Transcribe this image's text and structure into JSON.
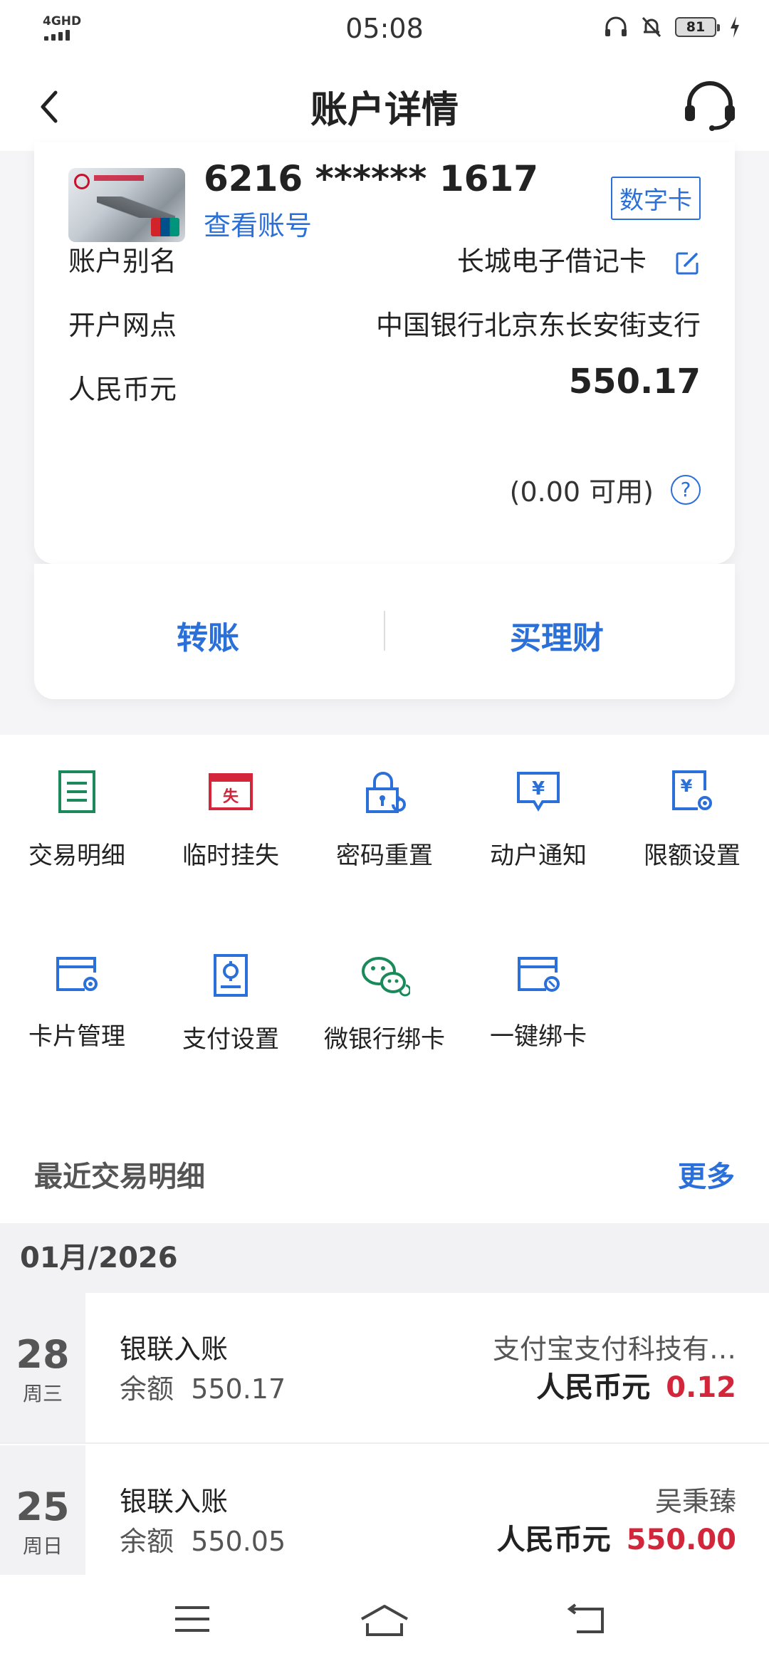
{
  "status_bar": {
    "network": "4GHD",
    "time": "05:08",
    "battery": "81"
  },
  "nav": {
    "title": "账户详情"
  },
  "account": {
    "card_number": "6216 ****** 1617",
    "view_account": "查看账号",
    "card_type_badge": "数字卡",
    "rows": [
      {
        "label": "账户别名",
        "value": "长城电子借记卡"
      },
      {
        "label": "开户网点",
        "value": "中国银行北京东长安街支行"
      },
      {
        "label": "人民币元",
        "value": "550.17"
      }
    ],
    "available": "(0.00 可用)"
  },
  "actions": {
    "transfer": "转账",
    "buy_wealth": "买理财"
  },
  "services": [
    {
      "label": "交易明细",
      "icon": "ledger-icon"
    },
    {
      "label": "临时挂失",
      "icon": "report-loss-icon"
    },
    {
      "label": "密码重置",
      "icon": "password-reset-icon"
    },
    {
      "label": "动户通知",
      "icon": "yuan-notify-icon"
    },
    {
      "label": "限额设置",
      "icon": "limit-settings-icon"
    },
    {
      "label": "卡片管理",
      "icon": "card-manage-icon"
    },
    {
      "label": "支付设置",
      "icon": "payment-settings-icon"
    },
    {
      "label": "微银行绑卡",
      "icon": "wechat-bind-icon"
    },
    {
      "label": "一键绑卡",
      "icon": "one-click-bind-icon"
    }
  ],
  "recent": {
    "title": "最近交易明细",
    "more": "更多",
    "month": "01月/2026",
    "transactions": [
      {
        "day": "28",
        "weekday": "周三",
        "type": "银联入账",
        "balance_label": "余额",
        "balance": "550.17",
        "party": "支付宝支付科技有…",
        "currency": "人民币元",
        "amount": "0.12"
      },
      {
        "day": "25",
        "weekday": "周日",
        "type": "银联入账",
        "balance_label": "余额",
        "balance": "550.05",
        "party": "吴秉臻",
        "currency": "人民币元",
        "amount": "550.00"
      }
    ]
  },
  "colors": {
    "accent": "#2b6fd8",
    "amount_red": "#d3263a",
    "green_icon": "#1a8a5a",
    "red_icon": "#d3263a"
  }
}
